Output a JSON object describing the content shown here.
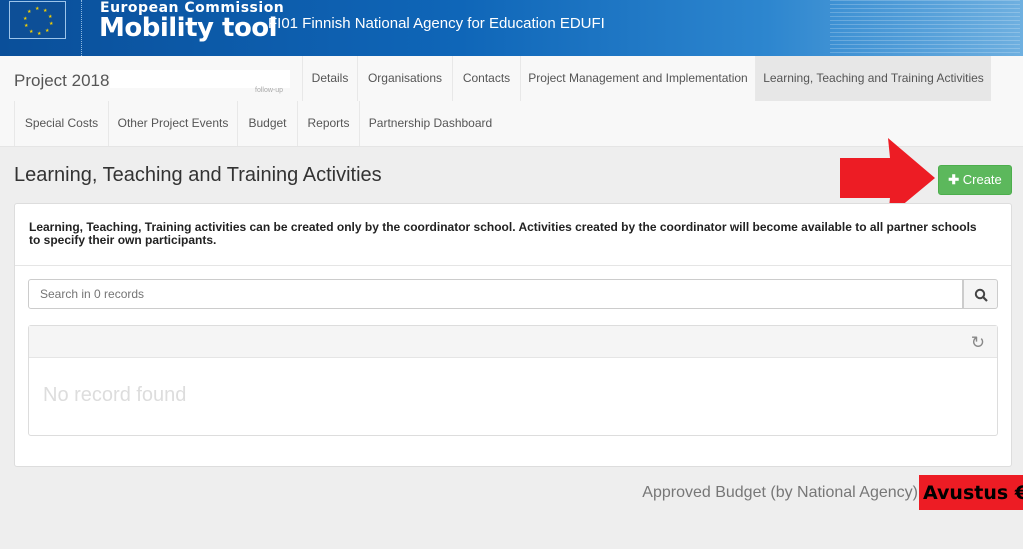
{
  "header": {
    "org": "European Commission",
    "app": "Mobility tool",
    "agency": "FI01 Finnish National Agency for Education EDUFI"
  },
  "project": {
    "title": "Project 2018-",
    "sublabel": "follow-up"
  },
  "tabs": [
    {
      "label": "Details"
    },
    {
      "label": "Organisations"
    },
    {
      "label": "Contacts"
    },
    {
      "label": "Project Management and Implementation"
    },
    {
      "label": "Learning, Teaching and Training Activities",
      "active": true
    },
    {
      "label": "Special Costs"
    },
    {
      "label": "Other Project Events"
    },
    {
      "label": "Budget"
    },
    {
      "label": "Reports"
    },
    {
      "label": "Partnership Dashboard"
    }
  ],
  "main": {
    "title": "Learning, Teaching and Training Activities",
    "create_label": "Create",
    "info": "Learning, Teaching, Training activities can be created only by the coordinator school. Activities created by the coordinator will become available to all partner schools to specify their own participants.",
    "search_placeholder": "Search in 0 records",
    "empty": "No record found"
  },
  "footer": {
    "budget_label": "Approved Budget (by National Agency)",
    "annotation": "Avustus €"
  },
  "colors": {
    "header": "#0f66b8",
    "create": "#5cb85c",
    "arrow": "#ed1c24"
  },
  "icons": {
    "create": "plus-icon",
    "search": "search-icon",
    "refresh": "refresh-icon",
    "annotation": "red-arrow"
  }
}
